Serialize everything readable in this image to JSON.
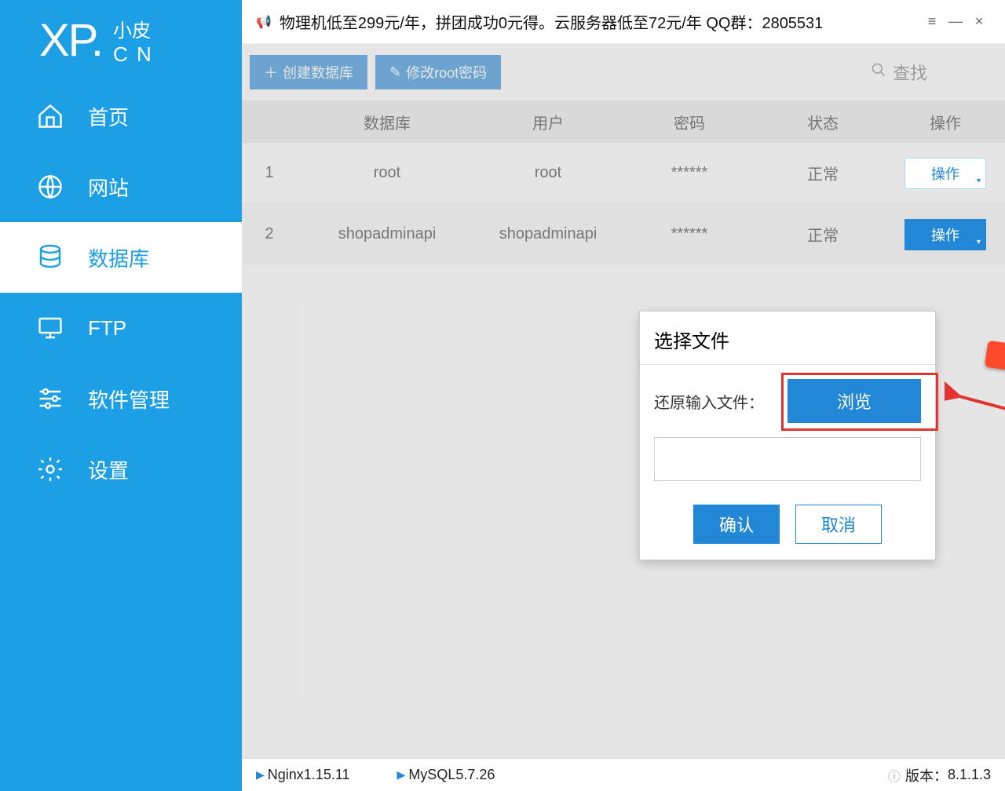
{
  "logo": {
    "main": "XP.",
    "sub1": "小皮",
    "sub2": "C N"
  },
  "sidebar": {
    "items": [
      {
        "label": "首页"
      },
      {
        "label": "网站"
      },
      {
        "label": "数据库"
      },
      {
        "label": "FTP"
      },
      {
        "label": "软件管理"
      },
      {
        "label": "设置"
      }
    ]
  },
  "titlebar": {
    "announcement": "物理机低至299元/年，拼团成功0元得。云服务器低至72元/年  QQ群：2805531"
  },
  "toolbar": {
    "create_db": "创建数据库",
    "change_root_pwd": "修改root密码",
    "search_placeholder": "查找"
  },
  "table": {
    "headers": {
      "db": "数据库",
      "user": "用户",
      "pwd": "密码",
      "status": "状态",
      "action": "操作"
    },
    "rows": [
      {
        "idx": "1",
        "db": "root",
        "user": "root",
        "pwd": "******",
        "status": "正常",
        "action": "操作"
      },
      {
        "idx": "2",
        "db": "shopadminapi",
        "user": "shopadminapi",
        "pwd": "******",
        "status": "正常",
        "action": "操作"
      }
    ]
  },
  "modal": {
    "title": "选择文件",
    "restore_label": "还原输入文件：",
    "browse": "浏览",
    "input_value": "",
    "ok": "确认",
    "cancel": "取消"
  },
  "statusbar": {
    "nginx": "Nginx1.15.11",
    "mysql": "MySQL5.7.26",
    "version_label": "版本：",
    "version": "8.1.1.3"
  }
}
